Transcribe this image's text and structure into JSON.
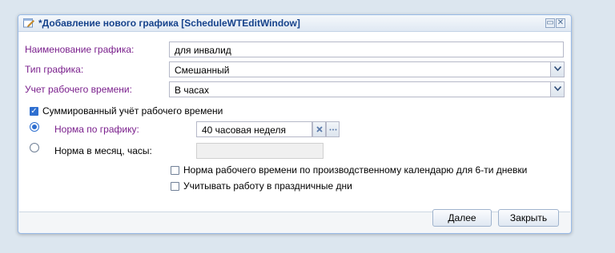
{
  "window": {
    "title": "*Добавление нового графика [ScheduleWTEditWindow]",
    "restore_glyph": "▭",
    "close_glyph": "✕"
  },
  "form": {
    "name_label": "Наименование графика:",
    "name_value": "для инвалид",
    "type_label": "Тип графика:",
    "type_value": "Смешанный",
    "accounting_label": "Учет рабочего времени:",
    "accounting_value": "В часах",
    "summed_label": "Суммированный учёт рабочего времени",
    "summed_checked": true,
    "norm_schedule_label": "Норма по графику:",
    "norm_schedule_value": "40 часовая неделя",
    "norm_month_label": "Норма в месяц, часы:",
    "norm_month_value": "",
    "calendar_label": "Норма рабочего времени по производственному календарю для 6-ти дневки",
    "calendar_checked": false,
    "holidays_label": "Учитывать работу в праздничные дни",
    "holidays_checked": false
  },
  "buttons": {
    "next": "Далее",
    "close": "Закрыть"
  },
  "icons": {
    "window": "edit-window-icon",
    "dropdown": "chevron-down-icon",
    "clear": "clear-icon",
    "ellipsis": "ellipsis-icon"
  },
  "colors": {
    "label_purple": "#7a1f8c",
    "title_blue": "#15428b",
    "window_border": "#99bbe8",
    "page_background": "#dce6ef"
  }
}
